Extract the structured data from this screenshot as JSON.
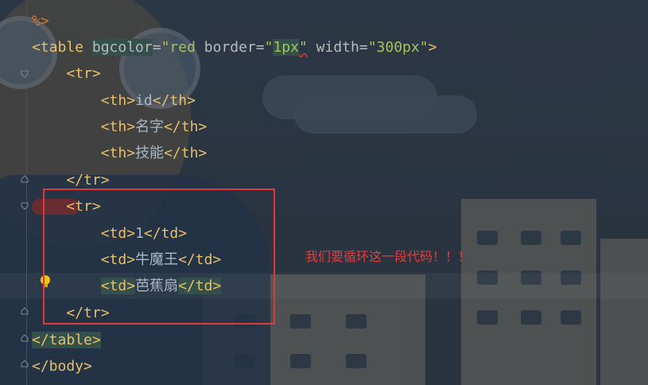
{
  "editor": {
    "lines": [
      {
        "prefix": "",
        "parts": [
          {
            "t": "%>",
            "c": "pct"
          }
        ]
      },
      {
        "prefix": "",
        "parts": [
          {
            "t": "<table ",
            "c": "tag"
          },
          {
            "t": "bgcolor",
            "c": "attr hl"
          },
          {
            "t": "=",
            "c": "attr"
          },
          {
            "t": "\"red ",
            "c": "val"
          },
          {
            "t": "border",
            "c": "attr"
          },
          {
            "t": "=",
            "c": "attr"
          },
          {
            "t": "\"",
            "c": "val"
          },
          {
            "t": "1px",
            "c": "val hl"
          },
          {
            "t": "\"",
            "c": "val under"
          },
          {
            "t": " width",
            "c": "attr"
          },
          {
            "t": "=",
            "c": "attr"
          },
          {
            "t": "\"300px\"",
            "c": "val"
          },
          {
            "t": ">",
            "c": "tag"
          }
        ]
      },
      {
        "prefix": "    ",
        "parts": [
          {
            "t": "<tr>",
            "c": "tag"
          }
        ]
      },
      {
        "prefix": "        ",
        "parts": [
          {
            "t": "<th>",
            "c": "tag"
          },
          {
            "t": "id",
            "c": "txt"
          },
          {
            "t": "</th>",
            "c": "tag"
          }
        ]
      },
      {
        "prefix": "        ",
        "parts": [
          {
            "t": "<th>",
            "c": "tag"
          },
          {
            "t": "名字",
            "c": "txt"
          },
          {
            "t": "</th>",
            "c": "tag"
          }
        ]
      },
      {
        "prefix": "        ",
        "parts": [
          {
            "t": "<th>",
            "c": "tag"
          },
          {
            "t": "技能",
            "c": "txt"
          },
          {
            "t": "</th>",
            "c": "tag"
          }
        ]
      },
      {
        "prefix": "    ",
        "parts": [
          {
            "t": "</tr>",
            "c": "tag"
          }
        ]
      },
      {
        "prefix": "    ",
        "parts": [
          {
            "t": "<tr>",
            "c": "tag"
          }
        ]
      },
      {
        "prefix": "        ",
        "parts": [
          {
            "t": "<td>",
            "c": "tag"
          },
          {
            "t": "1",
            "c": "txt"
          },
          {
            "t": "</td>",
            "c": "tag"
          }
        ]
      },
      {
        "prefix": "        ",
        "parts": [
          {
            "t": "<td>",
            "c": "tag"
          },
          {
            "t": "牛魔王",
            "c": "txt"
          },
          {
            "t": "</td>",
            "c": "tag"
          }
        ]
      },
      {
        "prefix": "        ",
        "parts": [
          {
            "t": "<td>",
            "c": "tag hl"
          },
          {
            "t": "芭蕉扇",
            "c": "txt"
          },
          {
            "t": "</td>",
            "c": "tag hl"
          }
        ]
      },
      {
        "prefix": "    ",
        "parts": [
          {
            "t": "</tr>",
            "c": "tag"
          }
        ]
      },
      {
        "prefix": "",
        "parts": [
          {
            "t": "</table>",
            "c": "tag hl"
          }
        ]
      },
      {
        "prefix": "",
        "parts": [
          {
            "t": "</body>",
            "c": "tag"
          }
        ]
      }
    ],
    "annotation": "我们要循环这一段代码！！！",
    "colors": {
      "tag": "#e8bf6a",
      "attr": "#bababa",
      "value": "#a5c25c",
      "text": "#a9b7c6",
      "annotation": "#e23c3c",
      "box": "#e0373a"
    },
    "icons": [
      "fold-icon",
      "intention-bulb-icon"
    ]
  }
}
